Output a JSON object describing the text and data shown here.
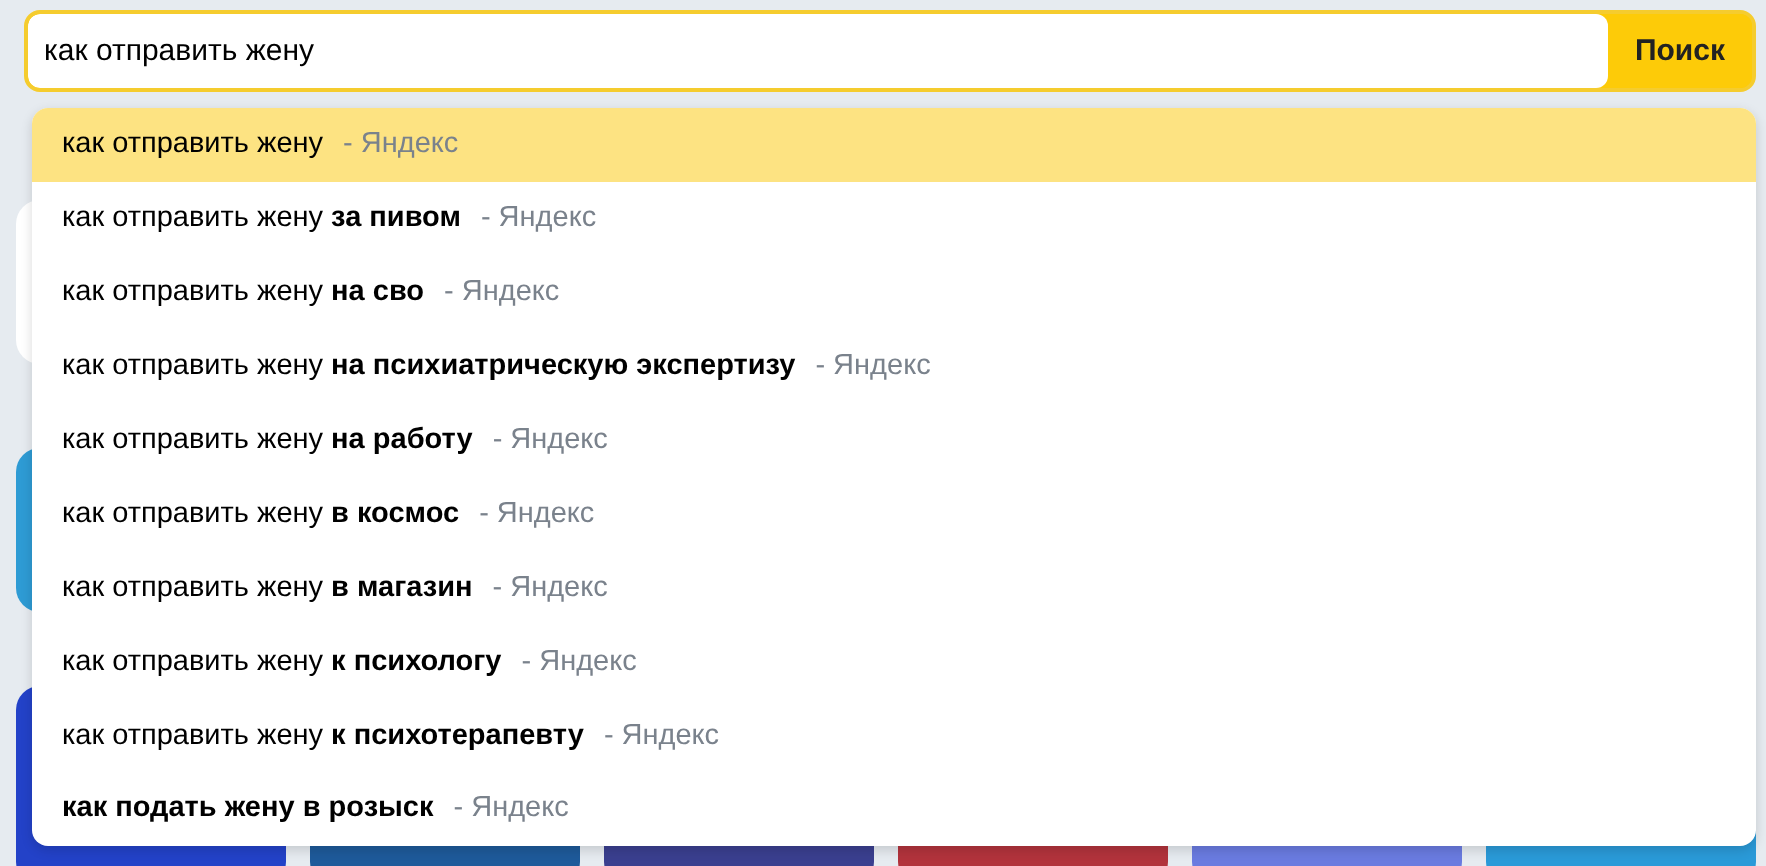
{
  "search": {
    "value": "как отправить жену",
    "button": "Поиск"
  },
  "suggestions": [
    {
      "text": "как отправить жену",
      "source": "- Яндекс",
      "selected": true
    },
    {
      "text": "как отправить жену **за пивом**",
      "source": "- Яндекс",
      "selected": false
    },
    {
      "text": "как отправить жену **на сво**",
      "source": "- Яндекс",
      "selected": false
    },
    {
      "text": "как отправить жену **на психиатрическую экспертизу**",
      "source": "- Яндекс",
      "selected": false
    },
    {
      "text": "как отправить жену **на работу**",
      "source": "- Яндекс",
      "selected": false
    },
    {
      "text": "как отправить жену **в космос**",
      "source": "- Яндекс",
      "selected": false
    },
    {
      "text": "как отправить жену **в магазин**",
      "source": "- Яндекс",
      "selected": false
    },
    {
      "text": "как отправить жену **к психологу**",
      "source": "- Яндекс",
      "selected": false
    },
    {
      "text": "как отправить жену **к психотерапевту**",
      "source": "- Яндекс",
      "selected": false
    },
    {
      "text": "**как подать жену в розыск**",
      "source": "- Яндекс",
      "selected": false
    }
  ]
}
